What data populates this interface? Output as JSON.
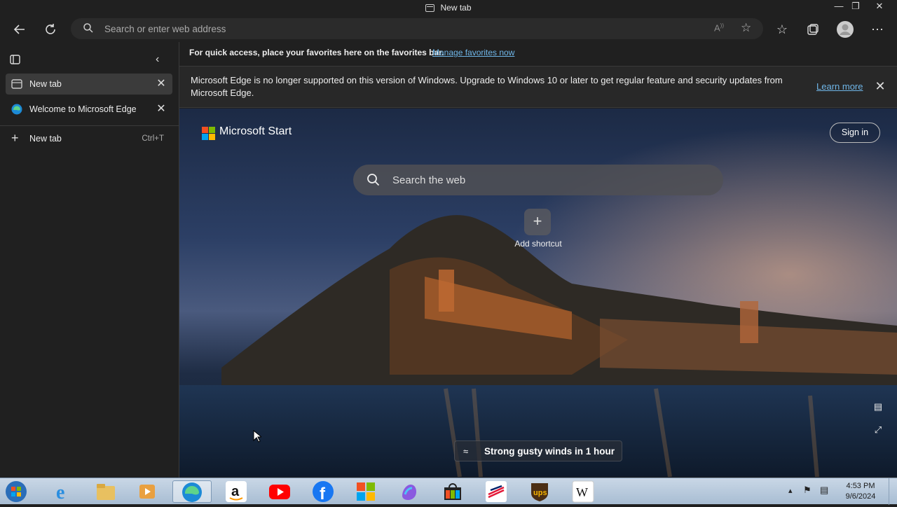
{
  "window": {
    "title": "New tab"
  },
  "toolbar": {
    "address_placeholder": "Search or enter web address"
  },
  "sidebar": {
    "tabs": [
      {
        "label": "New tab",
        "active": true
      },
      {
        "label": "Welcome to Microsoft Edge",
        "active": false
      }
    ],
    "new_tab_label": "New tab",
    "new_tab_shortcut": "Ctrl+T"
  },
  "favorites_bar": {
    "text": "For quick access, place your favorites here on the favorites bar.",
    "link": "Manage favorites now"
  },
  "infobar": {
    "message": "Microsoft Edge is no longer supported on this version of Windows. Upgrade to Windows 10 or later to get regular feature and security updates from Microsoft Edge.",
    "link": "Learn more"
  },
  "newtab": {
    "brand": "Microsoft Start",
    "sign_in": "Sign in",
    "search_placeholder": "Search the web",
    "add_shortcut": "Add shortcut",
    "weather": "Strong gusty winds in 1 hour"
  },
  "taskbar": {
    "time": "4:53 PM",
    "date": "9/6/2024",
    "apps": [
      "start-orb",
      "internet-explorer",
      "file-explorer",
      "media-player",
      "microsoft-edge",
      "amazon",
      "youtube",
      "facebook",
      "microsoft-store",
      "copilot",
      "office-store",
      "bank-of-america",
      "ups",
      "wikipedia"
    ]
  },
  "colors": {
    "accent_link": "#6fb6e8",
    "chrome_bg": "#202020"
  }
}
